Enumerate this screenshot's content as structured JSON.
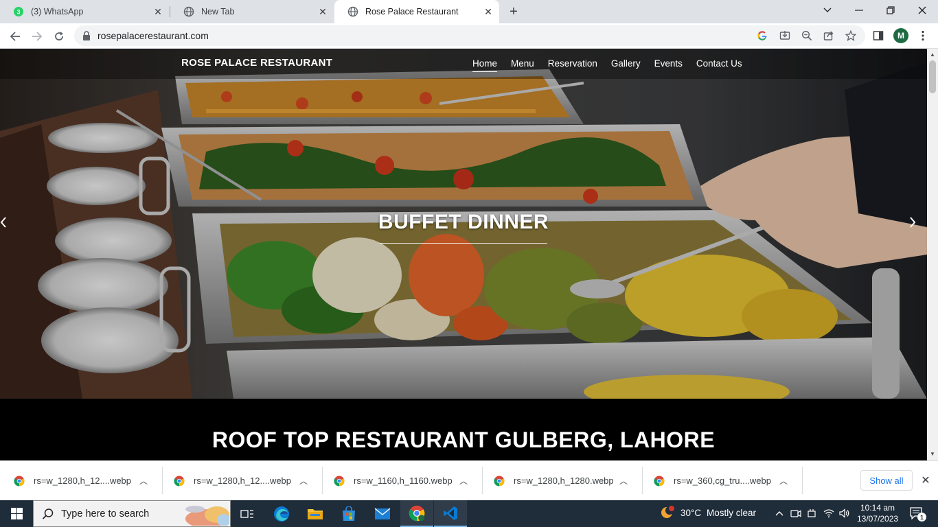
{
  "browser": {
    "tabs": [
      {
        "title": "(3) WhatsApp",
        "badge": "3",
        "icon": "whatsapp-icon",
        "active": false
      },
      {
        "title": "New Tab",
        "icon": "globe-icon",
        "active": false
      },
      {
        "title": "Rose Palace Restaurant",
        "icon": "globe-icon",
        "active": true
      }
    ],
    "url": "rosepalacerestaurant.com",
    "profile_initial": "M"
  },
  "site": {
    "brand": "ROSE PALACE RESTAURANT",
    "nav": [
      "Home",
      "Menu",
      "Reservation",
      "Gallery",
      "Events",
      "Contact Us"
    ],
    "active_nav": "Home",
    "hero_title": "BUFFET DINNER",
    "section_title": "ROOF TOP RESTAURANT GULBERG, LAHORE"
  },
  "downloads": {
    "items": [
      "rs=w_1280,h_12....webp",
      "rs=w_1280,h_12....webp",
      "rs=w_1160,h_1160.webp",
      "rs=w_1280,h_1280.webp",
      "rs=w_360,cg_tru....webp"
    ],
    "show_all": "Show all"
  },
  "taskbar": {
    "search_placeholder": "Type here to search",
    "weather_temp": "30°C",
    "weather_text": "Mostly clear",
    "time": "10:14 am",
    "date": "13/07/2023",
    "notification_count": "1"
  },
  "colors": {
    "tabstrip": "#dee1e6",
    "taskbar": "#1f2c3a",
    "link_blue": "#1a73e8",
    "profile_green": "#1e6a43"
  }
}
